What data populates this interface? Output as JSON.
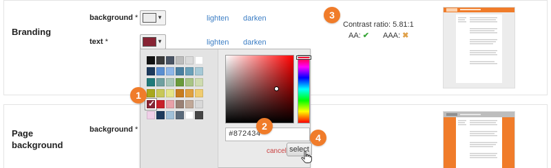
{
  "branding": {
    "title": "Branding",
    "background": {
      "label": "background",
      "required": "*",
      "chip_color": "#ececec",
      "lighten": "lighten",
      "darken": "darken"
    },
    "text": {
      "label": "text",
      "required": "*",
      "chip_color": "#872434",
      "lighten": "lighten",
      "darken": "darken"
    },
    "contrast": {
      "label": "Contrast ratio: 5.81:1",
      "aa_label": "AA:",
      "aa_icon": "check-icon",
      "aaa_label": "AAA:",
      "aaa_icon": "cross-icon"
    }
  },
  "page_background": {
    "title": "Page\nbackground",
    "background": {
      "label": "background",
      "required": "*"
    }
  },
  "picker": {
    "palette": [
      [
        "#111111",
        "#3a3a3a",
        "#4a5464",
        "#bcbcbc",
        "#dadada",
        "#ffffff"
      ],
      [
        "#1d3a5c",
        "#5b8fd1",
        "#8eb6e8",
        "#4a7fa0",
        "#6aa0b8",
        "#a6c9d6"
      ],
      [
        "#1f7a7a",
        "#6fa0a0",
        "#a9c6b8",
        "#6a9a3a",
        "#a8c484",
        "#cfdcb0"
      ],
      [
        "#a8a81e",
        "#c8c858",
        "#e4e488",
        "#c87c1e",
        "#e0a040",
        "#f0cc70"
      ],
      [
        "#872434",
        "#c8202a",
        "#e8a0a8",
        "#9a8074",
        "#c0a898",
        "#d8d8d8"
      ],
      [
        "#f0d0e8",
        "#1d3a5c",
        "#a0c0d8",
        "#5a6a7a",
        "#ffffff",
        "#454545"
      ]
    ],
    "selected_row": 4,
    "selected_col": 0,
    "hex_value": "#872434",
    "hue_color": "#ff0000",
    "cancel_label": "cancel",
    "select_label": "select"
  },
  "callouts": [
    "1",
    "2",
    "3",
    "4"
  ],
  "colors": {
    "accent": "#f07c2a",
    "link": "#3b7dc4",
    "cancel": "#c94040"
  }
}
